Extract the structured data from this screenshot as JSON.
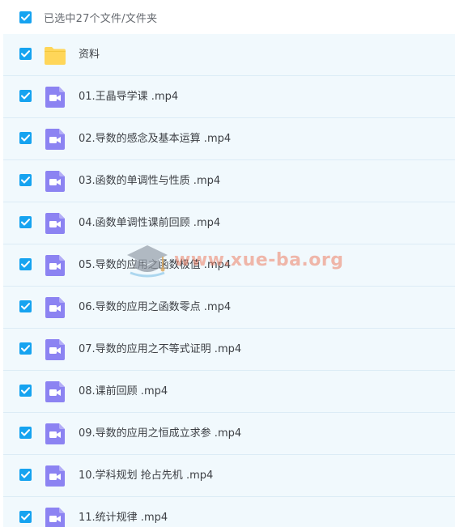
{
  "header": {
    "label": "已选中27个文件/文件夹",
    "checked": true
  },
  "items": [
    {
      "name": "资料",
      "type": "folder",
      "checked": true
    },
    {
      "name": "01.王晶导学课 .mp4",
      "type": "video",
      "checked": true
    },
    {
      "name": "02.导数的感念及基本运算 .mp4",
      "type": "video",
      "checked": true
    },
    {
      "name": "03.函数的单调性与性质 .mp4",
      "type": "video",
      "checked": true
    },
    {
      "name": "04.函数单调性课前回顾 .mp4",
      "type": "video",
      "checked": true
    },
    {
      "name": "05.导数的应用之函数极值 .mp4",
      "type": "video",
      "checked": true
    },
    {
      "name": "06.导数的应用之函数零点 .mp4",
      "type": "video",
      "checked": true
    },
    {
      "name": "07.导数的应用之不等式证明 .mp4",
      "type": "video",
      "checked": true
    },
    {
      "name": "08.课前回顾 .mp4",
      "type": "video",
      "checked": true
    },
    {
      "name": "09.导数的应用之恒成立求参 .mp4",
      "type": "video",
      "checked": true
    },
    {
      "name": "10.学科规划 抢占先机 .mp4",
      "type": "video",
      "checked": true
    },
    {
      "name": "11.统计规律 .mp4",
      "type": "video",
      "checked": true
    }
  ],
  "watermark": {
    "text": "www.xue-ba.org",
    "icon": "graduation-cap-icon"
  },
  "colors": {
    "checkbox": "#16a3f0",
    "folder": "#ffd659",
    "video": "#8c83f2",
    "row_bg": "#f1f9fd",
    "divider": "#dcecf6"
  }
}
